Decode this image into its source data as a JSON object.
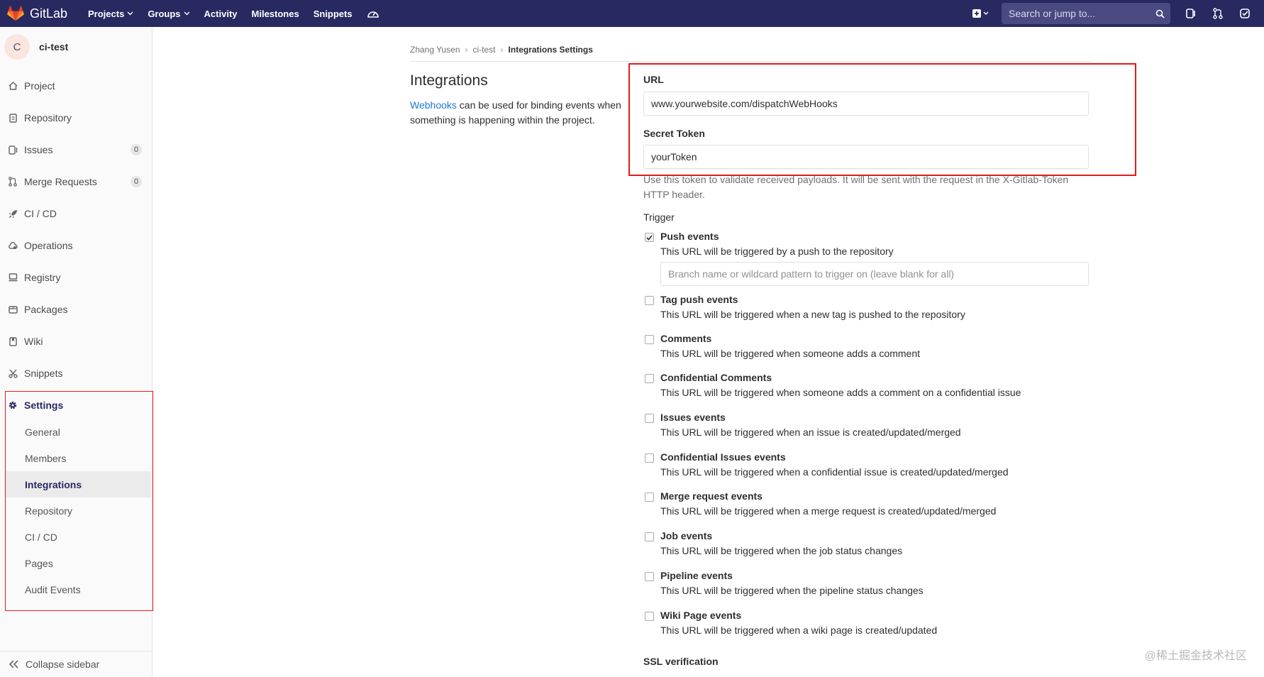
{
  "navbar": {
    "brand": "GitLab",
    "links": [
      {
        "label": "Projects",
        "dropdown": true
      },
      {
        "label": "Groups",
        "dropdown": true
      },
      {
        "label": "Activity",
        "dropdown": false
      },
      {
        "label": "Milestones",
        "dropdown": false
      },
      {
        "label": "Snippets",
        "dropdown": false
      }
    ],
    "search_placeholder": "Search or jump to..."
  },
  "sidebar": {
    "avatar_letter": "C",
    "project_name": "ci-test",
    "items": [
      {
        "label": "Project",
        "icon": "home-icon"
      },
      {
        "label": "Repository",
        "icon": "doc-icon"
      },
      {
        "label": "Issues",
        "icon": "issues-icon",
        "count": "0"
      },
      {
        "label": "Merge Requests",
        "icon": "merge-icon",
        "count": "0"
      },
      {
        "label": "CI / CD",
        "icon": "rocket-icon"
      },
      {
        "label": "Operations",
        "icon": "cloud-icon"
      },
      {
        "label": "Registry",
        "icon": "registry-icon"
      },
      {
        "label": "Packages",
        "icon": "package-icon"
      },
      {
        "label": "Wiki",
        "icon": "book-icon"
      },
      {
        "label": "Snippets",
        "icon": "scissors-icon"
      }
    ],
    "settings_label": "Settings",
    "settings_items": [
      "General",
      "Members",
      "Integrations",
      "Repository",
      "CI / CD",
      "Pages",
      "Audit Events"
    ],
    "active_settings_item": "Integrations",
    "collapse_label": "Collapse sidebar"
  },
  "breadcrumb": [
    "Zhang Yusen",
    "ci-test",
    "Integrations Settings"
  ],
  "section": {
    "title": "Integrations",
    "desc_link": "Webhooks",
    "desc_rest": " can be used for binding events when something is happening within the project."
  },
  "form": {
    "url_label": "URL",
    "url_value": "www.yourwebsite.com/dispatchWebHooks",
    "token_label": "Secret Token",
    "token_value": "yourToken",
    "token_help": "Use this token to validate received payloads. It will be sent with the request in the X-Gitlab-Token HTTP header.",
    "trigger_label": "Trigger",
    "branch_placeholder": "Branch name or wildcard pattern to trigger on (leave blank for all)",
    "triggers": [
      {
        "name": "Push events",
        "desc": "This URL will be triggered by a push to the repository",
        "checked": true
      },
      {
        "name": "Tag push events",
        "desc": "This URL will be triggered when a new tag is pushed to the repository",
        "checked": false
      },
      {
        "name": "Comments",
        "desc": "This URL will be triggered when someone adds a comment",
        "checked": false
      },
      {
        "name": "Confidential Comments",
        "desc": "This URL will be triggered when someone adds a comment on a confidential issue",
        "checked": false
      },
      {
        "name": "Issues events",
        "desc": "This URL will be triggered when an issue is created/updated/merged",
        "checked": false
      },
      {
        "name": "Confidential Issues events",
        "desc": "This URL will be triggered when a confidential issue is created/updated/merged",
        "checked": false
      },
      {
        "name": "Merge request events",
        "desc": "This URL will be triggered when a merge request is created/updated/merged",
        "checked": false
      },
      {
        "name": "Job events",
        "desc": "This URL will be triggered when the job status changes",
        "checked": false
      },
      {
        "name": "Pipeline events",
        "desc": "This URL will be triggered when the pipeline status changes",
        "checked": false
      },
      {
        "name": "Wiki Page events",
        "desc": "This URL will be triggered when a wiki page is created/updated",
        "checked": false
      }
    ],
    "ssl_label": "SSL verification"
  },
  "watermark": "@稀土掘金技术社区",
  "colors": {
    "navbar": "#292961",
    "highlight_box": "#e31b1b",
    "link": "#1f78d1"
  }
}
